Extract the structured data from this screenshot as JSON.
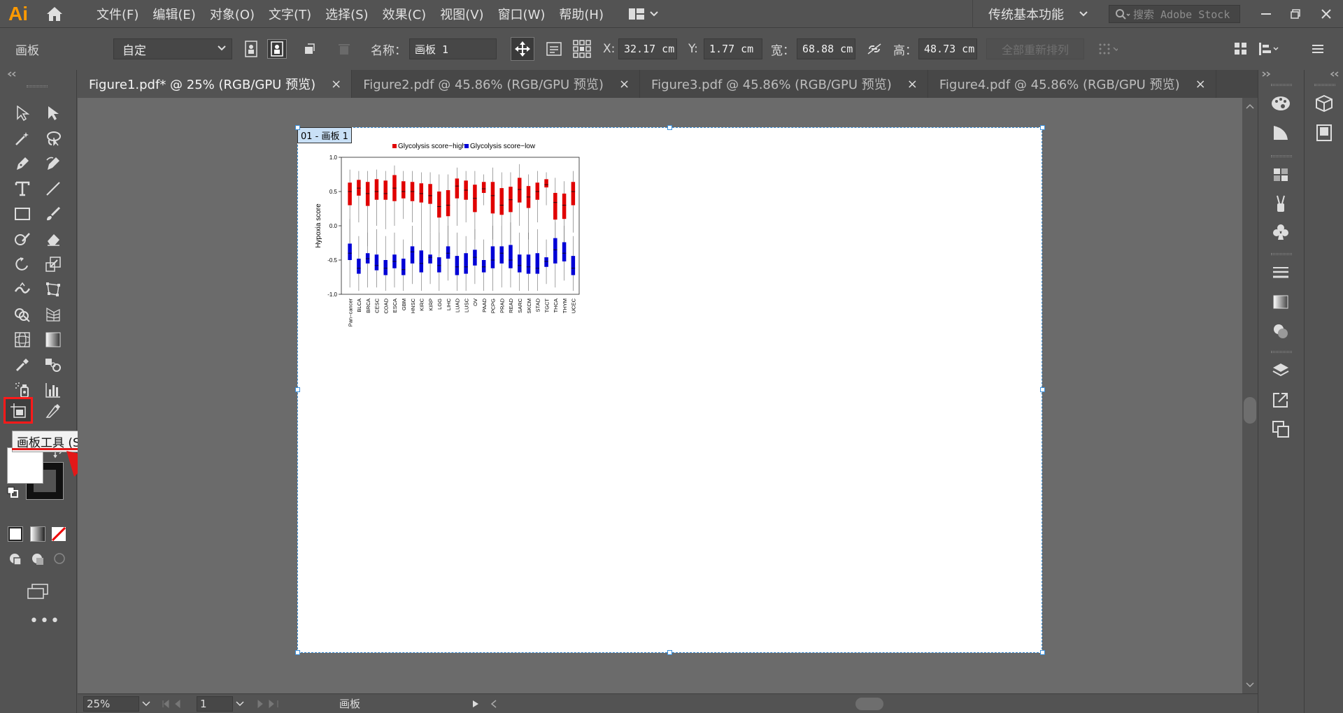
{
  "app": {
    "logo": "Ai"
  },
  "menu": [
    "文件(F)",
    "编辑(E)",
    "对象(O)",
    "文字(T)",
    "选择(S)",
    "效果(C)",
    "视图(V)",
    "窗口(W)",
    "帮助(H)"
  ],
  "workspace": "传统基本功能",
  "search_placeholder": "搜索 Adobe Stock",
  "control": {
    "panel_label": "画板",
    "preset": "自定",
    "name_label": "名称：",
    "name_value": "画板 1",
    "x_label": "X:",
    "x_value": "32.17 cm",
    "y_label": "Y:",
    "y_value": "1.77 cm",
    "w_label": "宽：",
    "w_value": "68.88 cm",
    "h_label": "高：",
    "h_value": "48.73 cm",
    "rearrange_label": "全部重新排列"
  },
  "tabs": [
    {
      "label": "Figure1.pdf* @ 25% (RGB/GPU 预览)",
      "active": true
    },
    {
      "label": "Figure2.pdf @ 45.86% (RGB/GPU 预览)",
      "active": false
    },
    {
      "label": "Figure3.pdf @ 45.86% (RGB/GPU 预览)",
      "active": false
    },
    {
      "label": "Figure4.pdf @ 45.86% (RGB/GPU 预览)",
      "active": false
    }
  ],
  "tooltip": "画板工具 (Shift+O)",
  "artboard_label": "01 - 画板 1",
  "status": {
    "zoom": "25%",
    "page": "1",
    "tool_name": "画板"
  },
  "colors": {
    "accent_red": "#e21818",
    "selection_blue": "#3b8fd9",
    "series_high": "#e00000",
    "series_low": "#0000d6"
  },
  "chart_data": {
    "type": "boxplot",
    "ylabel": "Hypoxia score",
    "ylim": [
      -1.0,
      1.0
    ],
    "yticks": [
      "1.0",
      "0.5",
      "0.0",
      "-0.5",
      "-1.0"
    ],
    "legend": [
      "Glycolysis score−high",
      "Glycolysis score−low"
    ],
    "categories": [
      "Pan−cancer",
      "BLCA",
      "BRCA",
      "CESC",
      "COAD",
      "ESCA",
      "GBM",
      "HNSC",
      "KIRC",
      "KIRP",
      "LGG",
      "LIHC",
      "LUAD",
      "LUSC",
      "OV",
      "PAAD",
      "PCPG",
      "PRAD",
      "READ",
      "SARC",
      "SKCM",
      "STAD",
      "TGCT",
      "THCA",
      "THYM",
      "UCEC"
    ],
    "series": [
      {
        "name": "Glycolysis score−high",
        "color": "#e00000",
        "q1": [
          0.3,
          0.44,
          0.29,
          0.38,
          0.38,
          0.36,
          0.4,
          0.36,
          0.34,
          0.32,
          0.12,
          0.14,
          0.4,
          0.38,
          0.2,
          0.48,
          0.18,
          0.16,
          0.2,
          0.34,
          0.26,
          0.38,
          0.56,
          0.09,
          0.1,
          0.3
        ],
        "median": [
          0.5,
          0.55,
          0.47,
          0.5,
          0.47,
          0.55,
          0.5,
          0.5,
          0.47,
          0.44,
          0.28,
          0.3,
          0.58,
          0.52,
          0.4,
          0.54,
          0.44,
          0.3,
          0.38,
          0.53,
          0.42,
          0.5,
          0.6,
          0.34,
          0.3,
          0.5
        ],
        "q3": [
          0.63,
          0.67,
          0.64,
          0.68,
          0.66,
          0.74,
          0.65,
          0.64,
          0.62,
          0.61,
          0.5,
          0.52,
          0.69,
          0.66,
          0.6,
          0.64,
          0.64,
          0.55,
          0.57,
          0.7,
          0.58,
          0.63,
          0.68,
          0.48,
          0.47,
          0.64
        ],
        "low": [
          -0.25,
          0.05,
          -0.3,
          0.0,
          -0.05,
          0.0,
          0.1,
          0.05,
          -0.05,
          -0.1,
          -0.4,
          -0.3,
          0.0,
          0.05,
          -0.2,
          0.3,
          -0.2,
          -0.3,
          -0.25,
          0.0,
          -0.2,
          0.05,
          0.3,
          -0.3,
          -0.35,
          -0.1
        ],
        "high": [
          0.82,
          0.8,
          0.8,
          0.82,
          0.8,
          0.88,
          0.8,
          0.8,
          0.78,
          0.78,
          0.75,
          0.75,
          0.85,
          0.8,
          0.8,
          0.75,
          0.85,
          0.78,
          0.78,
          0.9,
          0.75,
          0.8,
          0.78,
          0.7,
          0.65,
          0.8
        ]
      },
      {
        "name": "Glycolysis score−low",
        "color": "#0000d6",
        "q1": [
          -0.5,
          -0.7,
          -0.55,
          -0.65,
          -0.72,
          -0.62,
          -0.72,
          -0.55,
          -0.68,
          -0.55,
          -0.68,
          -0.48,
          -0.72,
          -0.7,
          -0.58,
          -0.68,
          -0.62,
          -0.55,
          -0.62,
          -0.68,
          -0.7,
          -0.7,
          -0.6,
          -0.55,
          -0.52,
          -0.72
        ],
        "median": [
          -0.4,
          -0.62,
          -0.48,
          -0.58,
          -0.62,
          -0.52,
          -0.64,
          -0.38,
          -0.55,
          -0.46,
          -0.58,
          -0.4,
          -0.6,
          -0.6,
          -0.46,
          -0.6,
          -0.5,
          -0.4,
          -0.5,
          -0.58,
          -0.6,
          -0.62,
          -0.52,
          -0.35,
          -0.4,
          -0.62
        ],
        "q3": [
          -0.26,
          -0.48,
          -0.4,
          -0.42,
          -0.5,
          -0.42,
          -0.48,
          -0.3,
          -0.36,
          -0.42,
          -0.46,
          -0.3,
          -0.44,
          -0.4,
          -0.35,
          -0.5,
          -0.3,
          -0.3,
          -0.28,
          -0.42,
          -0.42,
          -0.4,
          -0.46,
          -0.18,
          -0.24,
          -0.44
        ],
        "low": [
          -0.9,
          -0.95,
          -0.9,
          -0.9,
          -0.95,
          -0.9,
          -0.95,
          -0.85,
          -0.95,
          -0.85,
          -0.95,
          -0.8,
          -0.95,
          -0.95,
          -0.85,
          -0.95,
          -0.95,
          -0.9,
          -0.9,
          -0.95,
          -0.95,
          -0.95,
          -0.85,
          -0.9,
          -0.8,
          -0.95
        ],
        "high": [
          0.1,
          -0.15,
          -0.1,
          -0.05,
          -0.15,
          -0.1,
          -0.2,
          0.0,
          -0.05,
          -0.1,
          -0.1,
          0.0,
          -0.1,
          -0.15,
          -0.05,
          -0.2,
          0.0,
          0.0,
          0.05,
          -0.1,
          -0.1,
          -0.05,
          -0.2,
          0.05,
          0.0,
          -0.15
        ]
      }
    ]
  }
}
